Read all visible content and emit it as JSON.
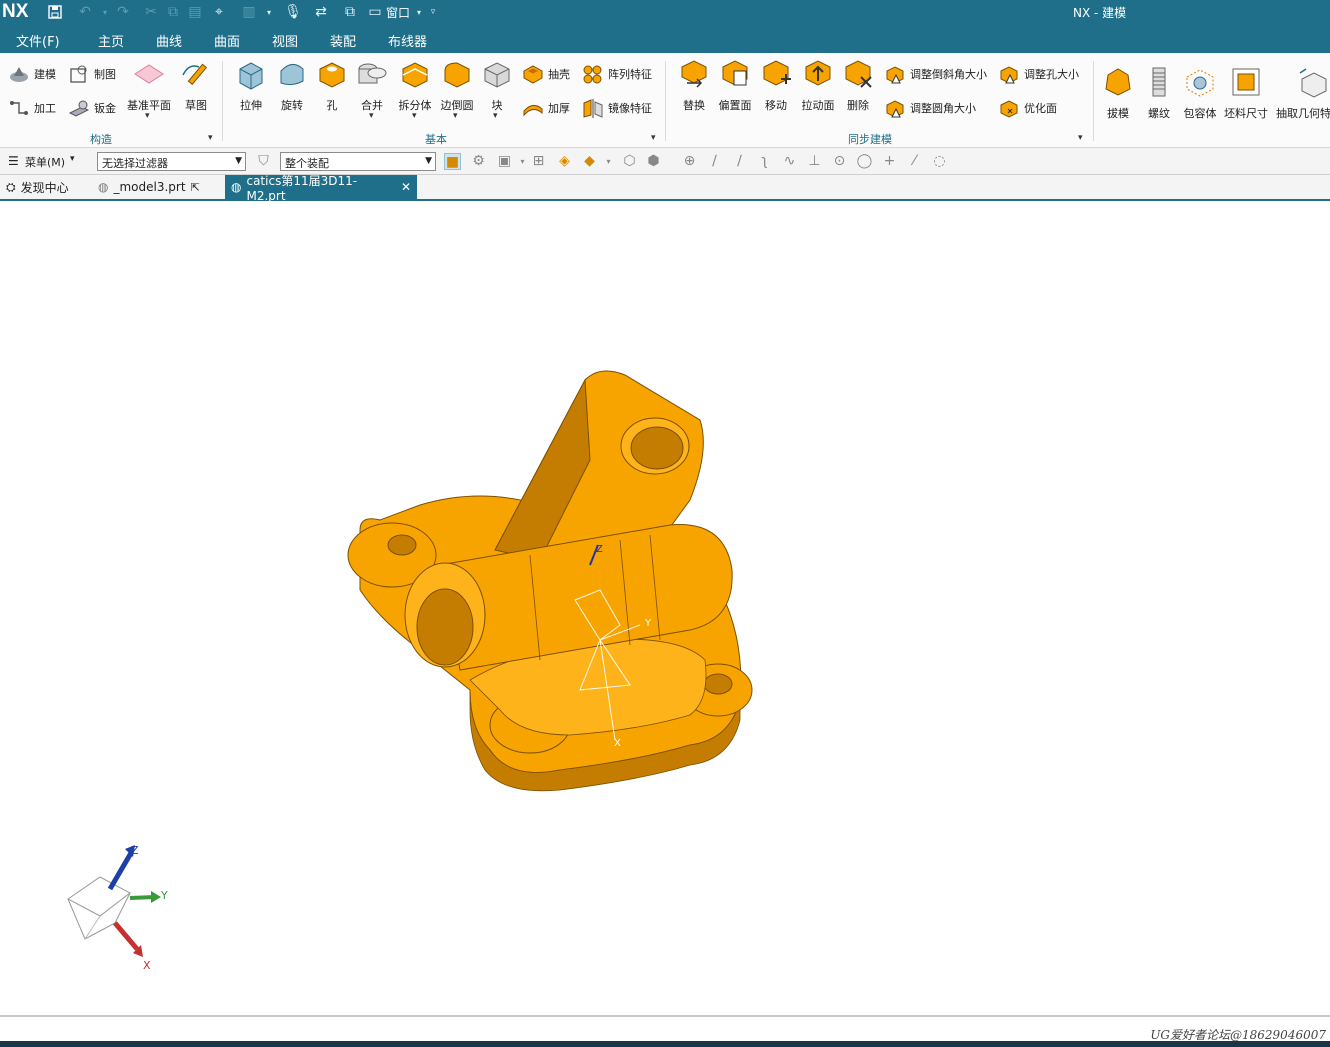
{
  "app": {
    "logo": "NX",
    "window_title": "NX - 建模",
    "window_menu": "窗口"
  },
  "colors": {
    "titlebar": "#1f6f8b",
    "accent_tab": "#ffd84d",
    "part": "#f7a400",
    "part_dark": "#c47d00"
  },
  "menubar": [
    {
      "label": "文件(F)",
      "active": false
    },
    {
      "label": "主页",
      "active": true
    },
    {
      "label": "曲线",
      "active": false
    },
    {
      "label": "曲面",
      "active": false
    },
    {
      "label": "视图",
      "active": false
    },
    {
      "label": "装配",
      "active": false
    },
    {
      "label": "布线器",
      "active": false
    }
  ],
  "ribbon": {
    "construct": {
      "label": "构造",
      "items": [
        "建模",
        "制图",
        "基准平面",
        "草图",
        "加工",
        "钣金"
      ]
    },
    "basic": {
      "label": "基本",
      "items": [
        "拉伸",
        "旋转",
        "孔",
        "合并",
        "拆分体",
        "边倒圆",
        "块",
        "抽壳",
        "阵列特征",
        "加厚",
        "镜像特征"
      ]
    },
    "sync": {
      "label": "同步建模",
      "items": [
        "替换",
        "偏置面",
        "移动",
        "拉动面",
        "删除",
        "调整倒斜角大小",
        "调整孔大小",
        "调整圆角大小",
        "优化面"
      ]
    },
    "extra": {
      "items": [
        "拔模",
        "螺纹",
        "包容体",
        "坯料尺寸",
        "抽取几何特"
      ]
    }
  },
  "toolbar": {
    "menu_label": "菜单(M)",
    "filter_value": "无选择过滤器",
    "scope_value": "整个装配"
  },
  "tabs": [
    {
      "label": "发现中心",
      "active": false
    },
    {
      "label": "_model3.prt",
      "active": false
    },
    {
      "label": "catics第11届3D11-M2.prt",
      "active": true
    }
  ],
  "triad": {
    "x": "X",
    "y": "Y",
    "z": "Z"
  },
  "watermark": "UG爱好者论坛@18629046007"
}
